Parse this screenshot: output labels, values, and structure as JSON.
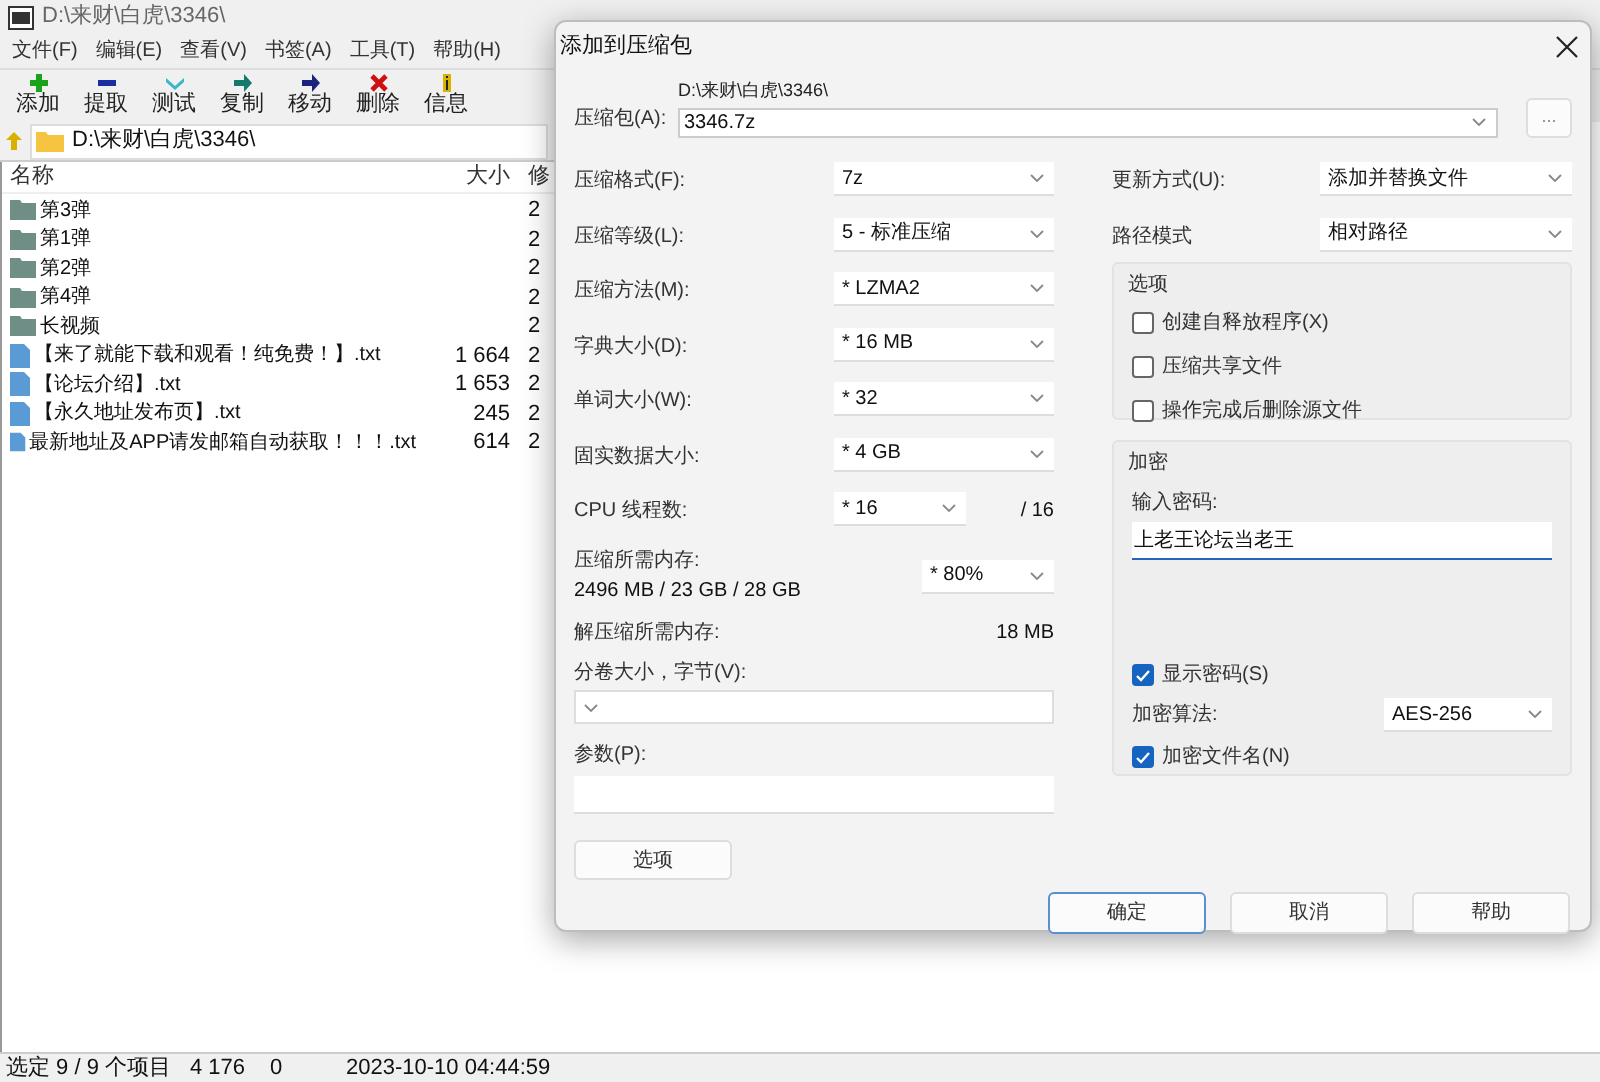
{
  "window": {
    "title": "D:\\来财\\白虎\\3346\\",
    "menu": [
      "文件(F)",
      "编辑(E)",
      "查看(V)",
      "书签(A)",
      "工具(T)",
      "帮助(H)"
    ],
    "toolbar": [
      {
        "kind": "add",
        "label": "添加"
      },
      {
        "kind": "extract",
        "label": "提取"
      },
      {
        "kind": "test",
        "label": "测试"
      },
      {
        "kind": "copy",
        "label": "复制"
      },
      {
        "kind": "move",
        "label": "移动"
      },
      {
        "kind": "delete",
        "label": "删除"
      },
      {
        "kind": "info",
        "label": "信息"
      }
    ],
    "address": "D:\\来财\\白虎\\3346\\",
    "columns": [
      "名称",
      "大小",
      "修"
    ],
    "rows": [
      {
        "kind": "folder",
        "name": "第3弹",
        "column_3": "2"
      },
      {
        "kind": "folder",
        "name": "第1弹",
        "column_3": "2"
      },
      {
        "kind": "folder",
        "name": "第2弹",
        "column_3": "2"
      },
      {
        "kind": "folder",
        "name": "第4弹",
        "column_3": "2"
      },
      {
        "kind": "folder",
        "name": "长视频",
        "column_3": "2"
      },
      {
        "kind": "file",
        "name": "【来了就能下载和观看！纯免费！】.txt",
        "size": "1 664",
        "column_3": "2"
      },
      {
        "kind": "file",
        "name": "【论坛介绍】.txt",
        "size": "1 653",
        "column_3": "2"
      },
      {
        "kind": "file",
        "name": "【永久地址发布页】.txt",
        "size": "245",
        "column_3": "2"
      },
      {
        "kind": "file",
        "name": "最新地址及APP请发邮箱自动获取！！！.txt",
        "size": "614",
        "column_3": "2"
      }
    ],
    "status_bar": [
      "选定 9 / 9 个项目",
      "4 176",
      "0",
      "2023-10-10 04:44:59"
    ]
  },
  "dialog": {
    "title": "添加到压缩包",
    "archive": {
      "label": "压缩包(A):",
      "folder": "D:\\来财\\白虎\\3346\\",
      "value": "3346.7z"
    },
    "browse_button": "...",
    "settings": [
      {
        "label": "压缩格式(F):",
        "value": "7z"
      },
      {
        "label": "压缩等级(L):",
        "value": "5 - 标准压缩"
      },
      {
        "label": "压缩方法(M):",
        "value": "*  LZMA2"
      },
      {
        "label": "字典大小(D):",
        "value": "*  16 MB"
      },
      {
        "label": "单词大小(W):",
        "value": "*  32"
      },
      {
        "label": "固实数据大小:",
        "value": "*  4 GB"
      }
    ],
    "cpu": {
      "label": "CPU 线程数:",
      "value": "*  16",
      "max": "/ 16"
    },
    "memory": {
      "label": "压缩所需内存:",
      "usage": "2496 MB / 23 GB / 28 GB",
      "value": "* 80%"
    },
    "decompress": {
      "label": "解压缩所需内存:",
      "value": "18 MB"
    },
    "volume": {
      "label": "分卷大小，字节(V):"
    },
    "params": {
      "label": "参数(P):"
    },
    "options_button": "选项",
    "update": {
      "label": "更新方式(U):",
      "value": "添加并替换文件"
    },
    "path_mode": {
      "label": "路径模式",
      "value": "相对路径"
    },
    "options_group": {
      "title": "选项",
      "checkboxes": [
        {
          "label": "创建自释放程序(X)",
          "checked": false
        },
        {
          "label": "压缩共享文件",
          "checked": false
        },
        {
          "label": "操作完成后删除源文件",
          "checked": false
        }
      ]
    },
    "encryption": {
      "title": "加密",
      "password_label": "输入密码:",
      "password": "上老王论坛当老王",
      "show_password": {
        "label": "显示密码(S)",
        "checked": true
      },
      "method_label": "加密算法:",
      "method": "AES-256",
      "encrypt_names": {
        "label": "加密文件名(N)",
        "checked": true
      }
    },
    "buttons": [
      {
        "label": "确定",
        "selected": true
      },
      {
        "label": "取消",
        "selected": false
      },
      {
        "label": "帮助",
        "selected": false
      }
    ]
  }
}
